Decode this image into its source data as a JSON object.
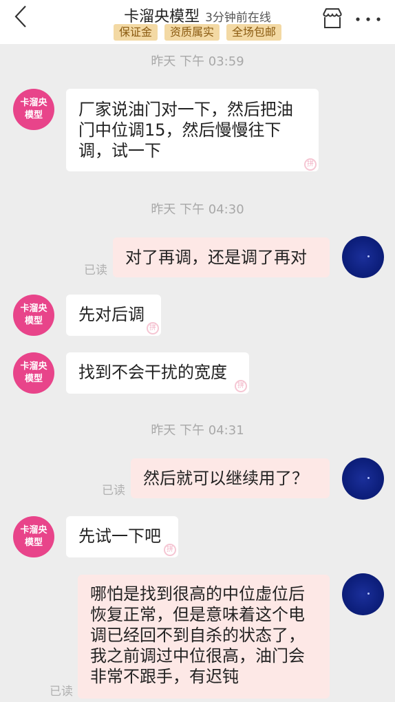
{
  "header": {
    "shop_name": "卡溜央模型",
    "online_status": "3分钟前在线",
    "tags": [
      "保证金",
      "资质属实",
      "全场包邮"
    ],
    "icons": {
      "back": "back-chevron-icon",
      "store": "store-icon",
      "more": "more-dots-icon"
    }
  },
  "avatar": {
    "shop_line1": "卡溜央",
    "shop_line2": "模型"
  },
  "timestamps": [
    "昨天 下午 03:59",
    "昨天 下午 04:30",
    "昨天 下午 04:31"
  ],
  "read_label": "已读",
  "pin_glyph": "拼",
  "messages": [
    {
      "from": "shop",
      "text": "厂家说油门对一下，然后把油门中位调15，然后慢慢往下调，试一下"
    },
    {
      "from": "me",
      "text": "对了再调，还是调了再对"
    },
    {
      "from": "shop",
      "text": "先对后调"
    },
    {
      "from": "shop",
      "text": "找到不会干扰的宽度"
    },
    {
      "from": "me",
      "text": "然后就可以继续用了？"
    },
    {
      "from": "shop",
      "text": "先试一下吧"
    },
    {
      "from": "me",
      "text": "哪怕是找到很高的中位虚位后恢复正常，但是意味着这个电调已经回不到自杀的状态了，我之前调过中位很高，油门会非常不跟手，有迟钝"
    }
  ],
  "colors": {
    "background": "#ededed",
    "incoming_bubble": "#ffffff",
    "outgoing_bubble": "#fde8e6",
    "shop_avatar": "#e8448a",
    "tag_bg": "#f3d9a4"
  }
}
